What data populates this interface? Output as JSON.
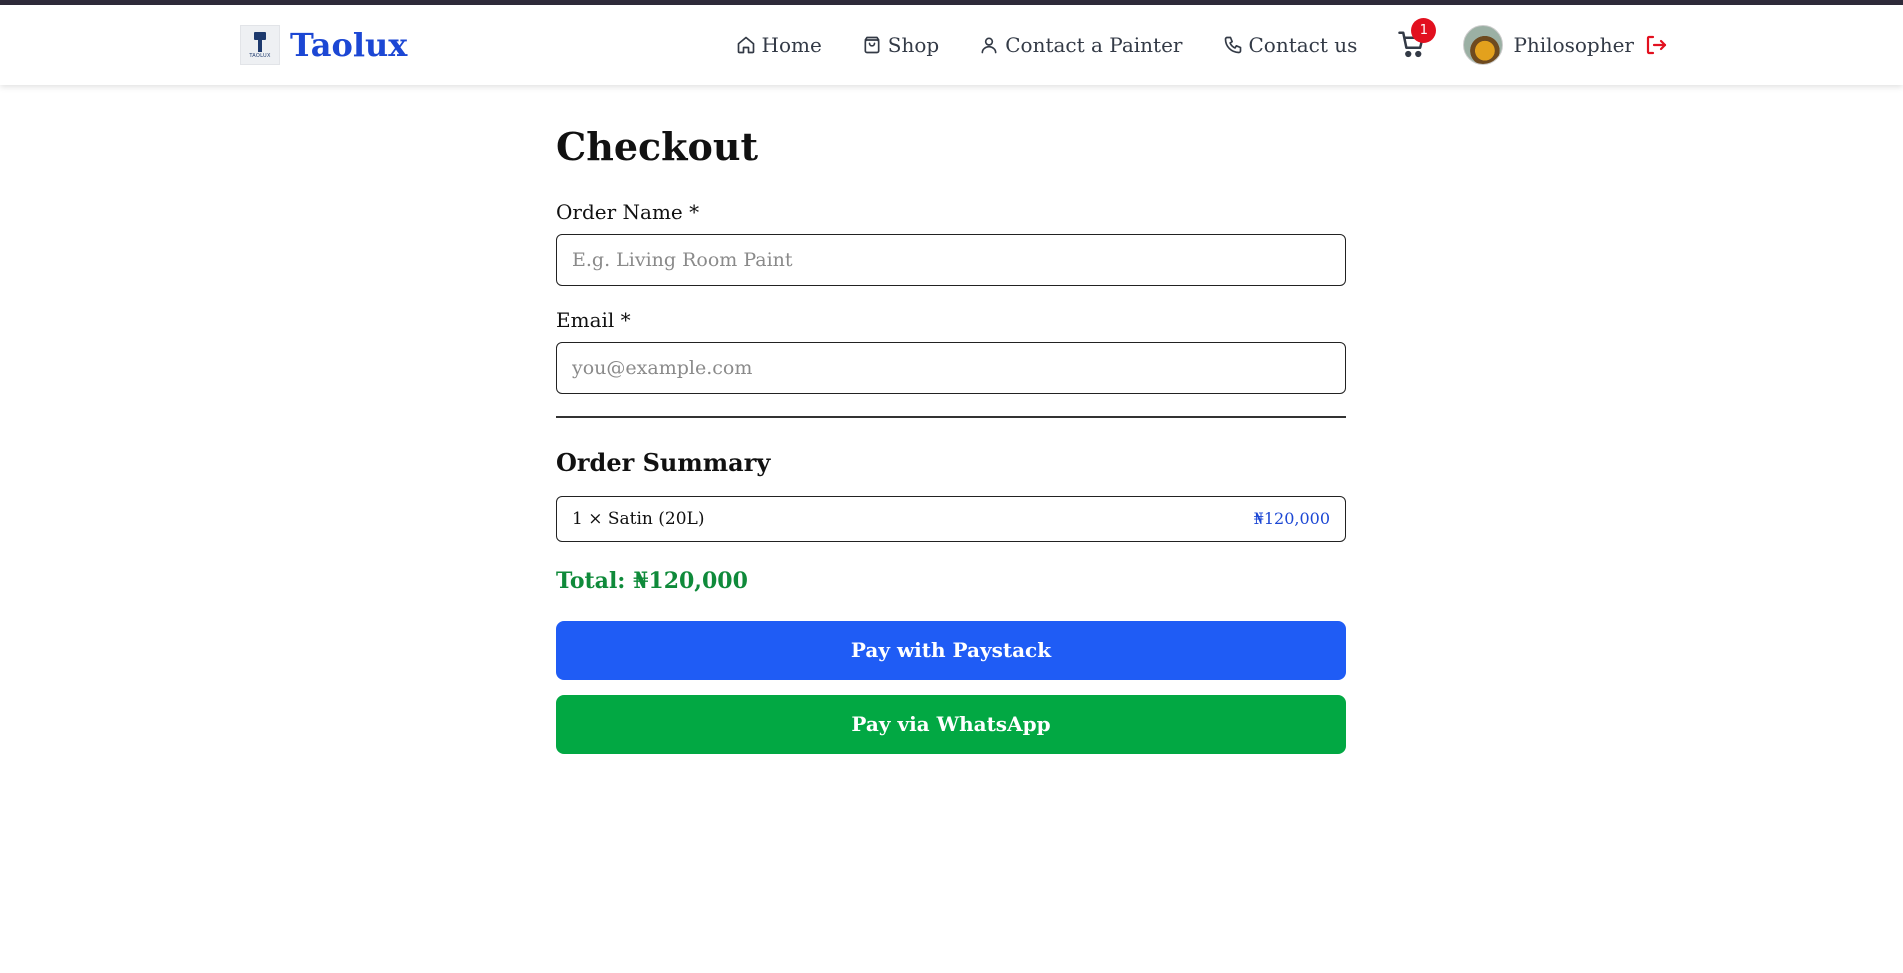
{
  "brand": {
    "name": "Taolux",
    "logo_text": "TAOLUX"
  },
  "nav": {
    "items": [
      {
        "label": "Home",
        "icon": "home-icon"
      },
      {
        "label": "Shop",
        "icon": "shopping-bag-icon"
      },
      {
        "label": "Contact a Painter",
        "icon": "user-icon"
      },
      {
        "label": "Contact us",
        "icon": "phone-icon"
      }
    ],
    "cart_count": "1",
    "user_name": "Philosopher"
  },
  "checkout": {
    "title": "Checkout",
    "order_name_label": "Order Name *",
    "order_name_placeholder": "E.g. Living Room Paint",
    "order_name_value": "",
    "email_label": "Email *",
    "email_placeholder": "you@example.com",
    "email_value": "",
    "summary_title": "Order Summary",
    "items": [
      {
        "description": "1 × Satin (20L)",
        "price": "₦120,000"
      }
    ],
    "total": "Total: ₦120,000",
    "pay_paystack_label": "Pay with Paystack",
    "pay_whatsapp_label": "Pay via WhatsApp"
  },
  "colors": {
    "brand": "#1c47d4",
    "badge": "#e2101f",
    "paystack": "#1f5cf5",
    "whatsapp": "#02a843",
    "total": "#0f8a3a",
    "logout": "#e2101f"
  }
}
